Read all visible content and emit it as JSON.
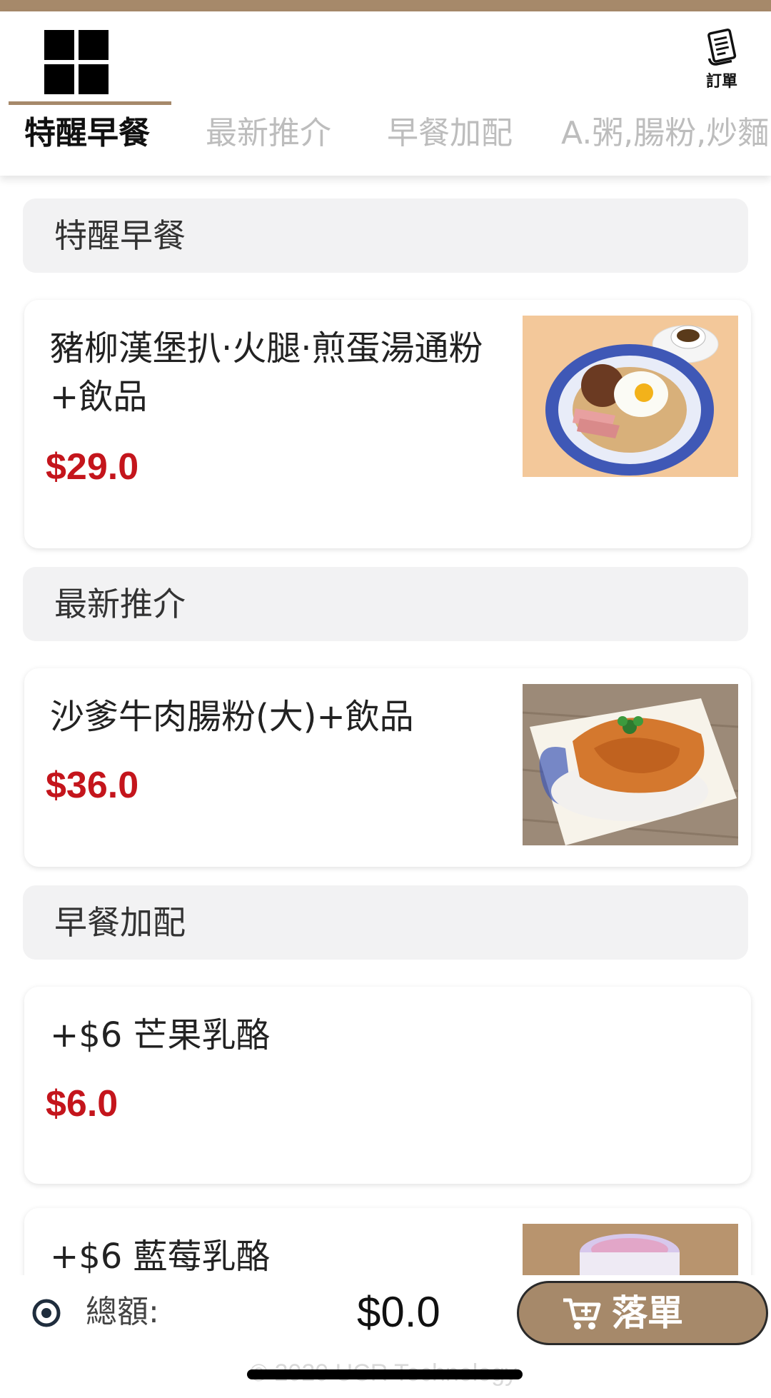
{
  "colors": {
    "accent": "#a6896a",
    "price": "#c4151c",
    "section_bg": "#f2f2f3",
    "tab_inactive": "#bdbdbd"
  },
  "header": {
    "menu_icon": "grid-icon",
    "orders_icon": "receipt-icon",
    "orders_label": "訂單"
  },
  "tabs": [
    {
      "label": "特醒早餐",
      "active": true
    },
    {
      "label": "最新推介",
      "active": false
    },
    {
      "label": "早餐加配",
      "active": false
    },
    {
      "label": "A.粥,腸粉,炒麵",
      "active": false
    }
  ],
  "sections": [
    {
      "title": "特醒早餐",
      "items": [
        {
          "name": "豬柳漢堡扒·火腿·煎蛋湯通粉+飲品",
          "price": "$29.0",
          "image": "breakfast-plate"
        }
      ]
    },
    {
      "title": "最新推介",
      "items": [
        {
          "name": "沙爹牛肉腸粉(大)+飲品",
          "price": "$36.0",
          "image": "rice-noodle-roll"
        }
      ]
    },
    {
      "title": "早餐加配",
      "items": [
        {
          "name": "+$6 芒果乳酪",
          "price": "$6.0",
          "image": ""
        },
        {
          "name": "+$6 藍莓乳酪",
          "price": "",
          "image": "yogurt-cup"
        }
      ]
    }
  ],
  "footer": {
    "total_label": "總額:",
    "total_value": "$0.0",
    "order_button_label": "落單",
    "order_icon": "cart-icon",
    "copyright": "© 2020 UCR Technology"
  }
}
